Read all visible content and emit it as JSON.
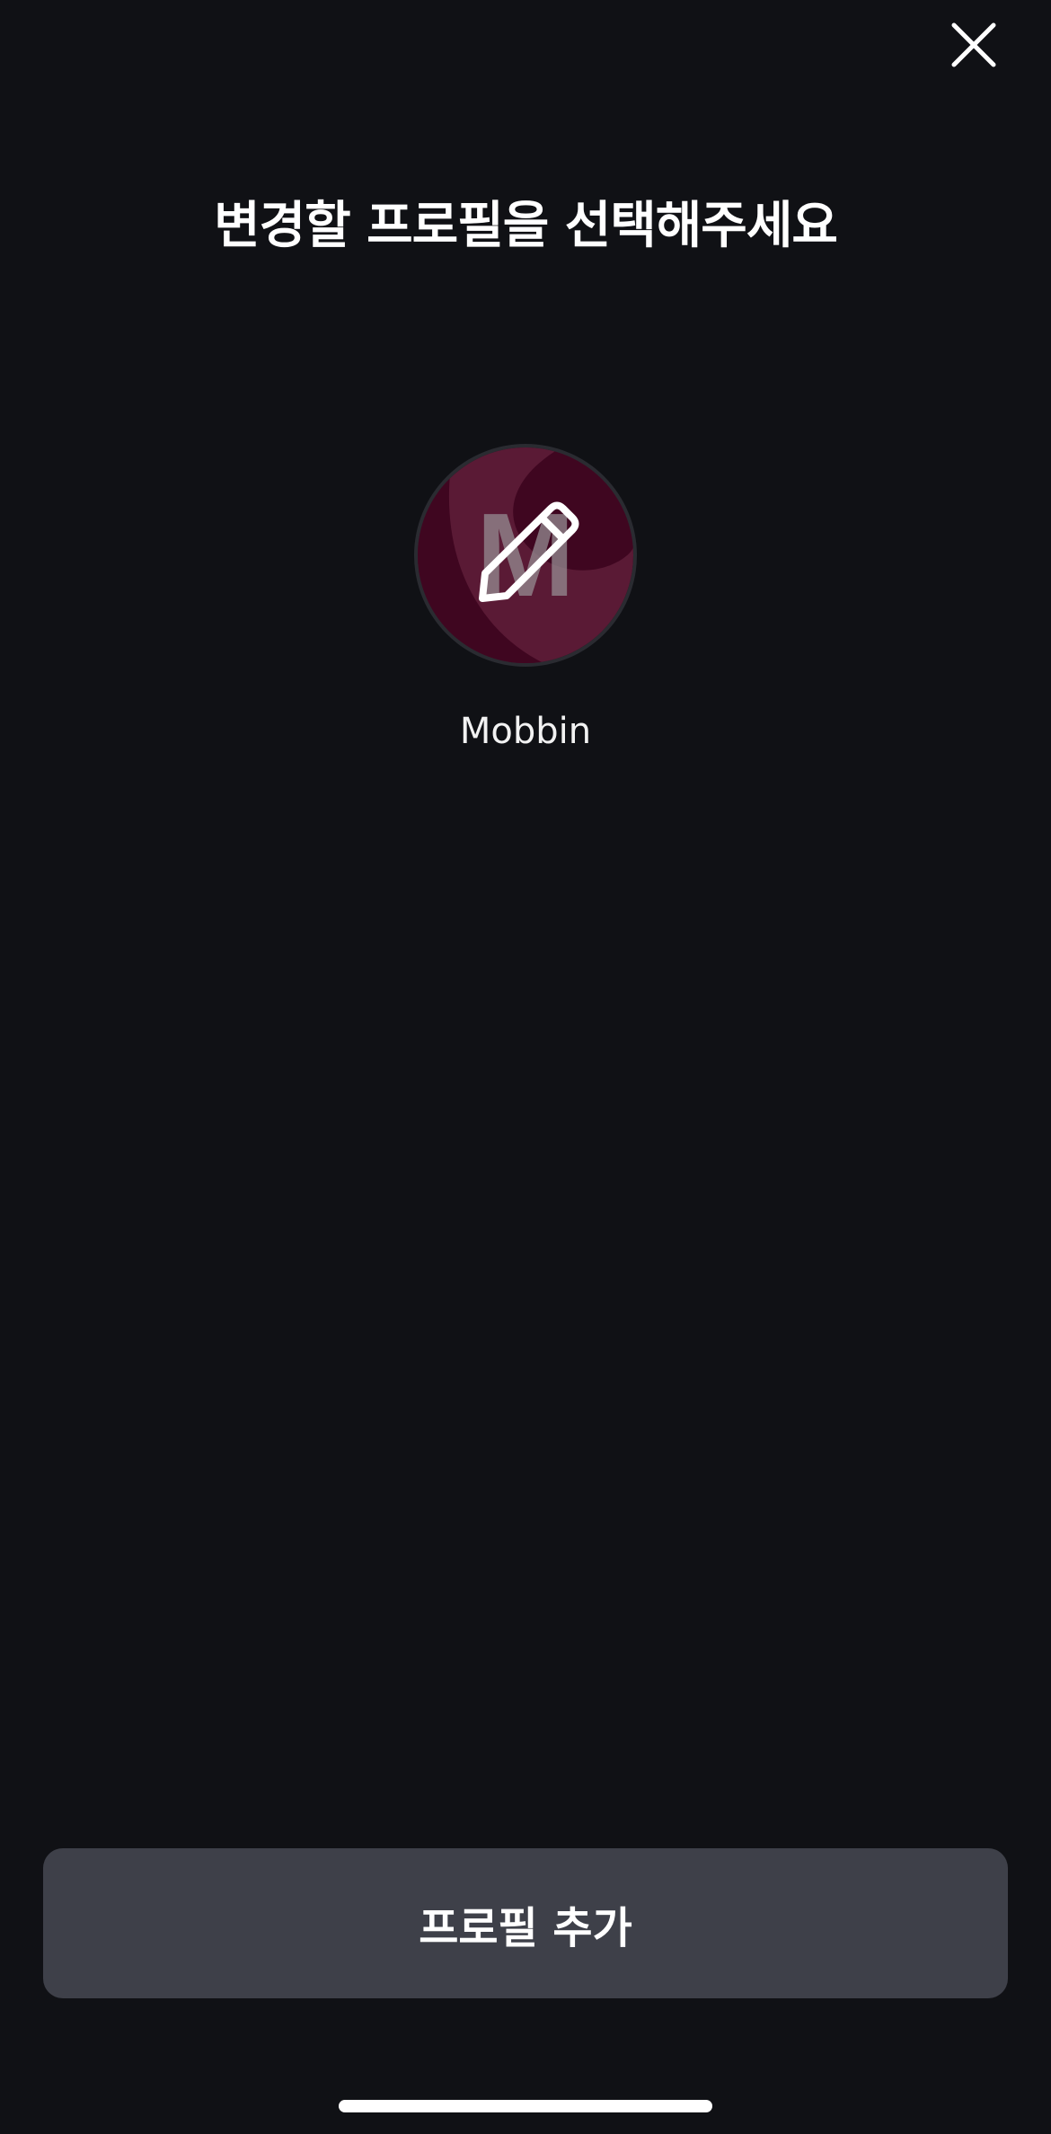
{
  "header": {
    "close_icon": "close-icon",
    "title": "변경할 프로필을 선택해주세요"
  },
  "profiles": [
    {
      "name": "Mobbin",
      "initial": "M",
      "avatar_color": "#5a1a35",
      "edit_icon": "pencil-icon"
    }
  ],
  "footer": {
    "add_profile_label": "프로필 추가"
  },
  "colors": {
    "background": "#101115",
    "button": "#3e4049",
    "accent": "#ffffff"
  }
}
